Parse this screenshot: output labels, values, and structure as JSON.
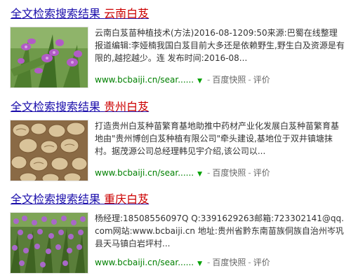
{
  "results": [
    {
      "title_prefix": "全文检索搜索结果",
      "title_keyword": "云南白芨",
      "thumbnail": "orchid-flowers-photo",
      "snippet": "云南白芨苗种植技术(方法)2016-08-1209:50来源:巴蜀在线整理报道编辑:李娅楠我国白芨目前大多还是依赖野生,野生白及资源是有限的,越挖越少。连 发布时间:2016-08...",
      "url": "www.bcbaiji.cn/sear......",
      "cache_label": "百度快照",
      "review_label": "评价"
    },
    {
      "title_prefix": "全文检索搜索结果",
      "title_keyword": "贵州白芨",
      "thumbnail": "dried-bletilla-tubers-photo",
      "snippet": "打造贵州白芨种苗繁育基地助推中药材产业化发展白芨种苗繁育基地由\"贵州博创白芨种植有限公司\"牵头建设,基地位于双井镇塘抹村。据茂源公司总经理韩见宇介绍,该公司以...",
      "url": "www.bcbaiji.cn/sear......",
      "cache_label": "百度快照",
      "review_label": "评价"
    },
    {
      "title_prefix": "全文检索搜索结果",
      "title_keyword": "重庆白芨",
      "thumbnail": "orchid-field-photo",
      "snippet": "杨经理:18508556097Q Q:3391629263邮箱:723302141@qq.com网站:www.bcbaiji.cn 地址:贵州省黔东南苗族侗族自治州岑巩县天马镇白岩坪村...",
      "url": "www.bcbaiji.cn/sear......",
      "cache_label": "百度快照",
      "review_label": "评价"
    }
  ],
  "colors": {
    "title_link": "#1a0dab",
    "title_keyword": "#cc0000",
    "url": "#008000",
    "snippet": "#333333"
  }
}
